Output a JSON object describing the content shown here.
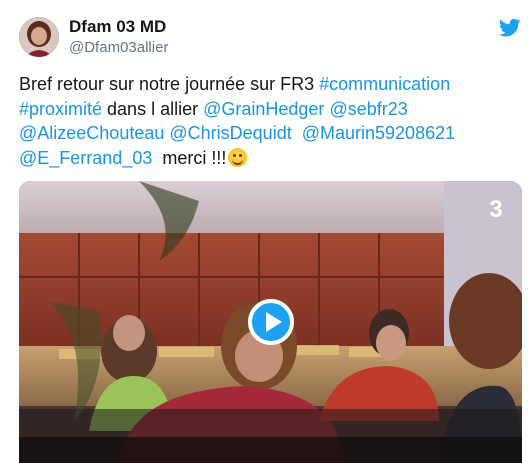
{
  "author": {
    "display_name": "Dfam 03 MD",
    "handle": "@Dfam03allier"
  },
  "tweet": {
    "segments": [
      {
        "text": "Bref retour sur notre journée sur FR3 ",
        "link": false
      },
      {
        "text": "#communication",
        "link": true
      },
      {
        "text": " ",
        "link": false
      },
      {
        "text": "#proximité",
        "link": true
      },
      {
        "text": " dans l allier ",
        "link": false
      },
      {
        "text": "@GrainHedger",
        "link": true
      },
      {
        "text": " ",
        "link": false
      },
      {
        "text": "@sebfr23",
        "link": true
      },
      {
        "text": " ",
        "link": false
      },
      {
        "text": "@AlizeeChouteau",
        "link": true
      },
      {
        "text": " ",
        "link": false
      },
      {
        "text": "@ChrisDequidt",
        "link": true
      },
      {
        "text": "  ",
        "link": false
      },
      {
        "text": "@Maurin59208621",
        "link": true
      },
      {
        "text": " ",
        "link": false
      },
      {
        "text": "@E_Ferrand_03",
        "link": true
      },
      {
        "text": "  merci !!!",
        "link": false
      }
    ],
    "emoji": "smiling-face-emoji"
  },
  "media": {
    "type": "video",
    "channel_logo": "3",
    "overlay_icon": "play-icon"
  },
  "icons": {
    "platform": "twitter-bird-icon",
    "avatar": "profile-photo"
  },
  "colors": {
    "link": "#1b95e0",
    "accent": "#1da1f2",
    "text": "#14171a",
    "secondary": "#657786"
  }
}
